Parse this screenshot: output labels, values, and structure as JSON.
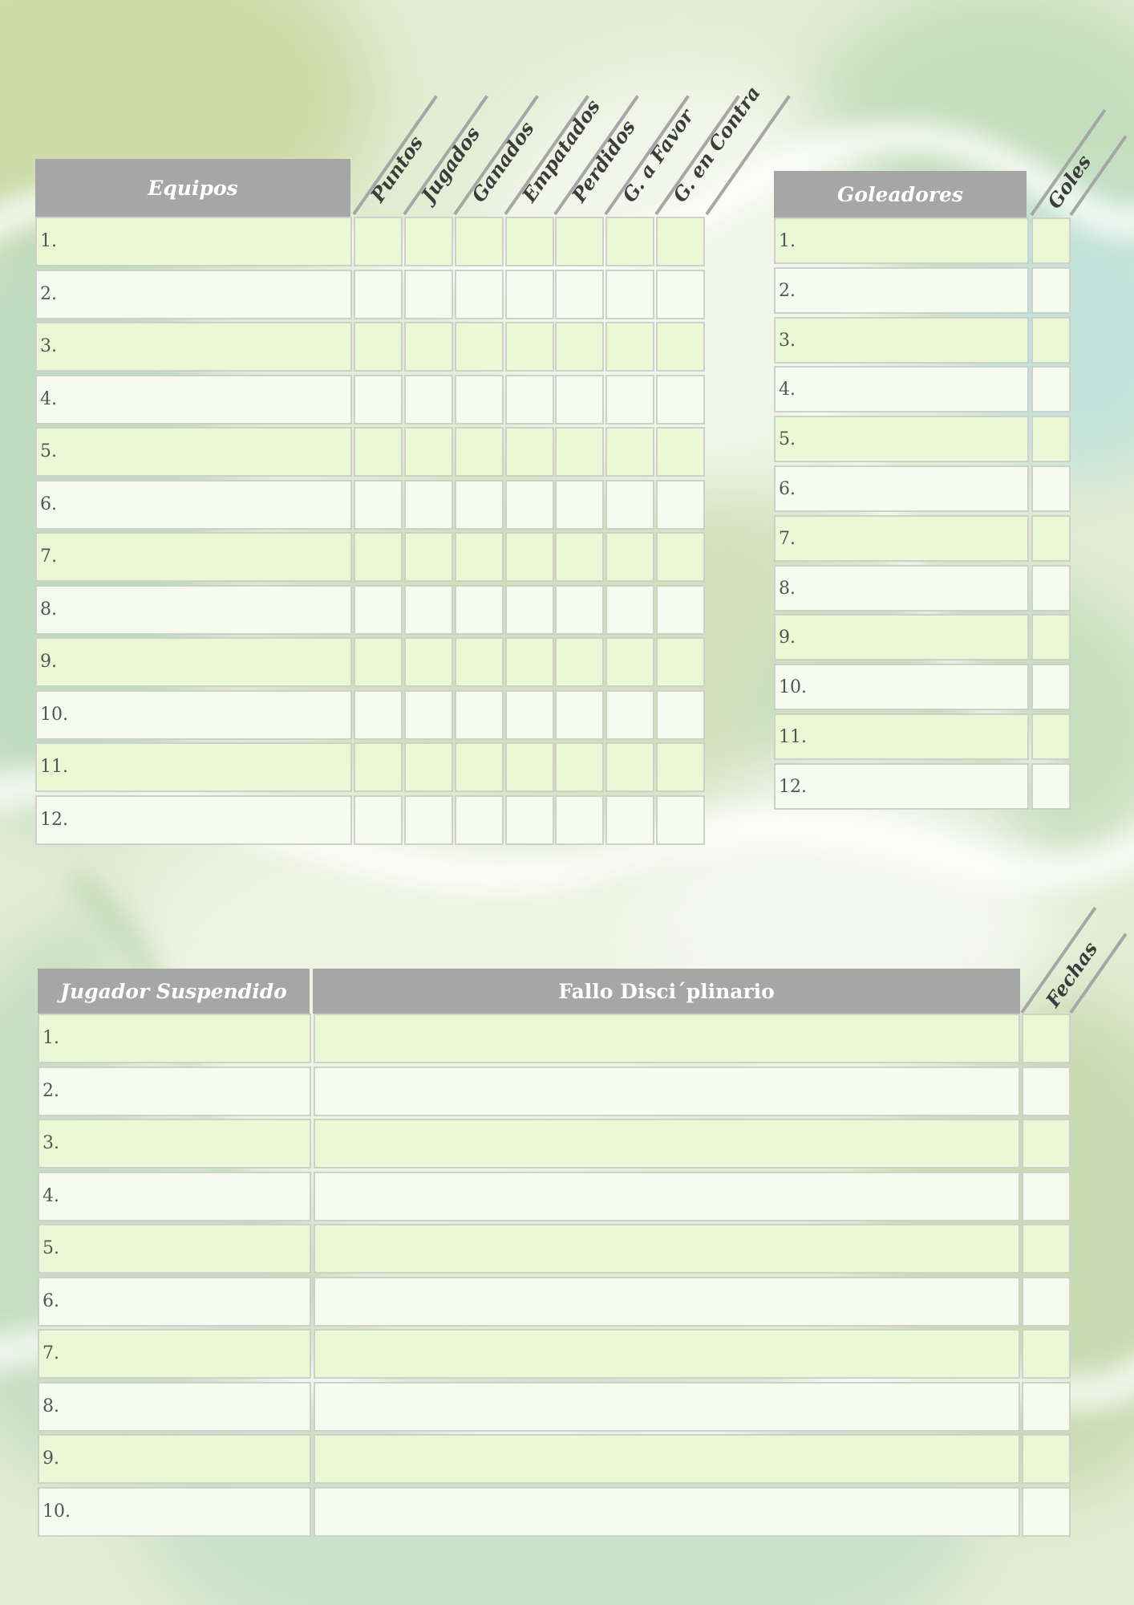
{
  "standings": {
    "header": "Equipos",
    "stat_columns": [
      "Puntos",
      "Jugados",
      "Ganados",
      "Empatados",
      "Perdidos",
      "G. a Favor",
      "G. en Contra"
    ],
    "rows": [
      "1.",
      "2.",
      "3.",
      "4.",
      "5.",
      "6.",
      "7.",
      "8.",
      "9.",
      "10.",
      "11.",
      "12."
    ]
  },
  "scorers": {
    "header": "Goleadores",
    "stat_column": "Goles",
    "rows": [
      "1.",
      "2.",
      "3.",
      "4.",
      "5.",
      "6.",
      "7.",
      "8.",
      "9.",
      "10.",
      "11.",
      "12."
    ]
  },
  "suspensions": {
    "player_header": "Jugador Suspendido",
    "ruling_header": "Fallo Disci´plinario",
    "dates_column": "Fechas",
    "rows": [
      "1.",
      "2.",
      "3.",
      "4.",
      "5.",
      "6.",
      "7.",
      "8.",
      "9.",
      "10."
    ]
  },
  "colors": {
    "header_gray": "#a6a6a6",
    "row_green": "#eaf8d6",
    "row_white": "#f6fbef",
    "border": "#cfd0cc",
    "text": "#555555"
  }
}
